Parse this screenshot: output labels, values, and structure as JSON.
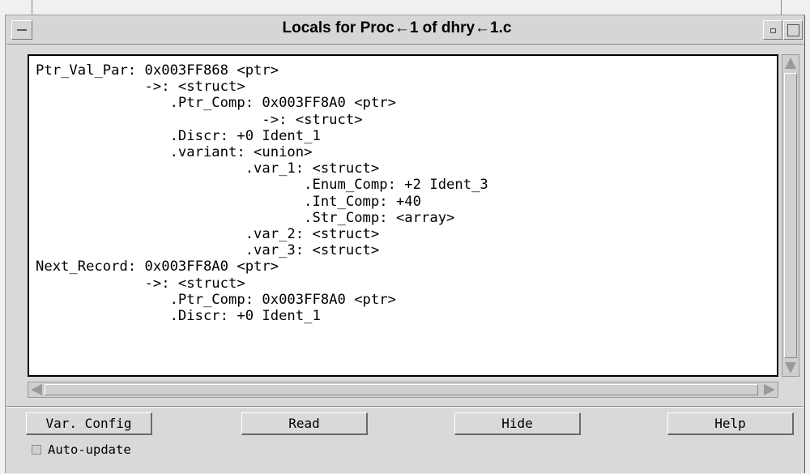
{
  "window": {
    "title": "Locals for Proc←1 of dhry←1.c"
  },
  "locals": {
    "lines": [
      "Ptr_Val_Par: 0x003FF868 <ptr>",
      "             ->: <struct>",
      "                .Ptr_Comp: 0x003FF8A0 <ptr>",
      "                           ->: <struct>",
      "                .Discr: +0 Ident_1",
      "                .variant: <union>",
      "                         .var_1: <struct>",
      "                                .Enum_Comp: +2 Ident_3",
      "                                .Int_Comp: +40",
      "                                .Str_Comp: <array>",
      "                         .var_2: <struct>",
      "                         .var_3: <struct>",
      "Next_Record: 0x003FF8A0 <ptr>",
      "             ->: <struct>",
      "                .Ptr_Comp: 0x003FF8A0 <ptr>",
      "                .Discr: +0 Ident_1"
    ]
  },
  "buttons": {
    "var_config": "Var. Config",
    "read": "Read",
    "hide": "Hide",
    "help": "Help"
  },
  "auto_update": {
    "label": "Auto-update",
    "checked": false
  }
}
